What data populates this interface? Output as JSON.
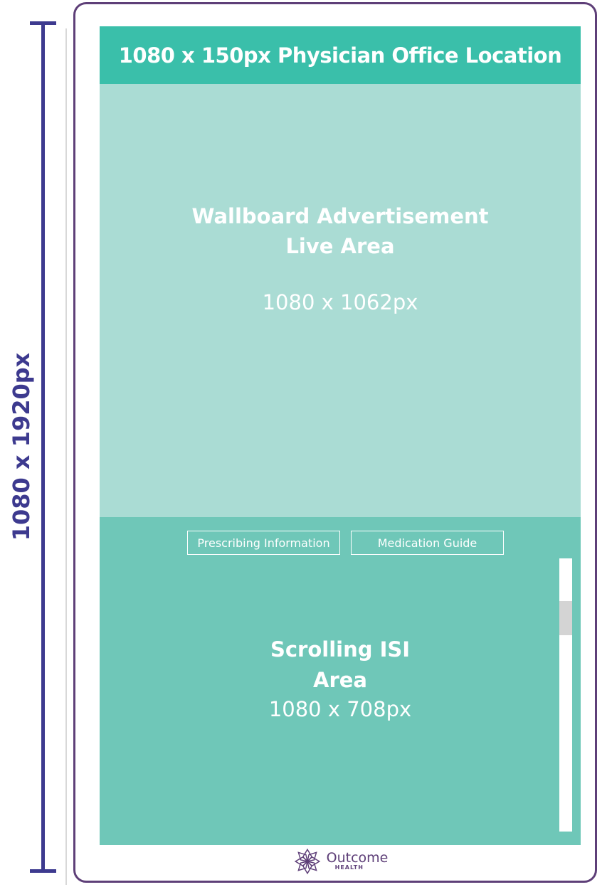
{
  "dimension_label": "1080 x 1920px",
  "header": {
    "title": "1080 x 150px Physician Office Location"
  },
  "live_area": {
    "title_line1": "Wallboard Advertisement",
    "title_line2": "Live Area",
    "size": "1080 x 1062px"
  },
  "isi_area": {
    "buttons": [
      {
        "label": "Prescribing Information"
      },
      {
        "label": "Medication Guide"
      }
    ],
    "title_line1": "Scrolling ISI",
    "title_line2": "Area",
    "size": "1080 x 708px"
  },
  "logo": {
    "name": "Outcome",
    "sub": "HEALTH"
  },
  "colors": {
    "accent_dark": "#3d3a8f",
    "frame": "#5e3f78",
    "header": "#3abfaa",
    "live_area": "#aadcd4",
    "isi_area": "#6fc7b8"
  }
}
